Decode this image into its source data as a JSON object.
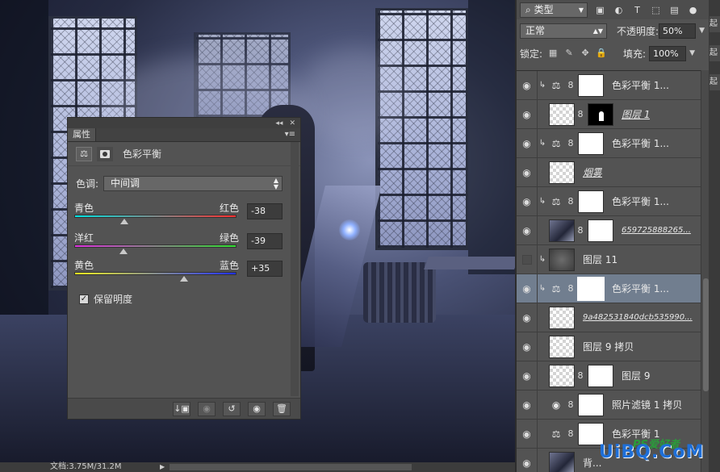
{
  "properties_panel": {
    "tab_label": "属性",
    "collapse_glyph": "◂◂",
    "close_glyph": "✕",
    "menu_glyph": "▾≡",
    "adjustment_name": "色彩平衡",
    "tone_label": "色调:",
    "tone_value": "中间调",
    "sliders": [
      {
        "left_label": "青色",
        "right_label": "红色",
        "value": "-38",
        "numeric": -38
      },
      {
        "left_label": "洋红",
        "right_label": "绿色",
        "value": "-39",
        "numeric": -39
      },
      {
        "left_label": "黄色",
        "right_label": "蓝色",
        "value": "+35",
        "numeric": 35
      }
    ],
    "preserve_luminosity_label": "保留明度",
    "preserve_luminosity_checked": true
  },
  "layers_panel": {
    "filter_label": "类型",
    "blend_mode": "正常",
    "opacity_label": "不透明度:",
    "opacity_value": "50%",
    "lock_label": "锁定:",
    "fill_label": "填充:",
    "fill_value": "100%",
    "layers": [
      {
        "name": "色彩平衡 1...",
        "visible": true,
        "clipped": true,
        "adjustment": true,
        "thumb": "white",
        "mask": true,
        "style": ""
      },
      {
        "name": "图层 1",
        "visible": true,
        "clipped": false,
        "adjustment": false,
        "thumb": "check",
        "mask_thumb": "black",
        "style": "u"
      },
      {
        "name": "色彩平衡 1...",
        "visible": true,
        "clipped": true,
        "adjustment": true,
        "thumb": "white",
        "mask": true,
        "style": ""
      },
      {
        "name": "烟雾",
        "visible": true,
        "clipped": false,
        "adjustment": false,
        "thumb": "check",
        "style": "u"
      },
      {
        "name": "色彩平衡 1...",
        "visible": true,
        "clipped": true,
        "adjustment": true,
        "thumb": "white",
        "mask": true,
        "style": ""
      },
      {
        "name": "659725888265...",
        "visible": true,
        "clipped": false,
        "adjustment": false,
        "thumb": "photo",
        "mask_thumb": "white",
        "style": "u small"
      },
      {
        "name": "图层 11",
        "visible": false,
        "clipped": true,
        "adjustment": false,
        "thumb": "gray",
        "style": ""
      },
      {
        "name": "色彩平衡 1...",
        "visible": true,
        "clipped": true,
        "adjustment": true,
        "thumb": "white",
        "mask": true,
        "style": "",
        "selected": true
      },
      {
        "name": "9a482531840dcb535990...",
        "visible": true,
        "clipped": false,
        "adjustment": false,
        "thumb": "check",
        "style": "u small"
      },
      {
        "name": "图层 9 拷贝",
        "visible": true,
        "clipped": false,
        "adjustment": false,
        "thumb": "check",
        "style": ""
      },
      {
        "name": "图层 9",
        "visible": true,
        "clipped": false,
        "adjustment": false,
        "thumb": "check",
        "mask_thumb": "white",
        "style": ""
      },
      {
        "name": "照片滤镜 1 拷贝",
        "visible": true,
        "clipped": false,
        "adjustment": true,
        "adj_icon": "◉",
        "thumb": "white",
        "mask": true,
        "style": ""
      },
      {
        "name": "色彩平衡 1",
        "visible": true,
        "clipped": false,
        "adjustment": true,
        "thumb": "white",
        "mask": true,
        "style": ""
      },
      {
        "name": "背...",
        "visible": true,
        "clipped": false,
        "adjustment": false,
        "thumb": "photo",
        "style": ""
      }
    ]
  },
  "status_bar": {
    "doc_info": "文档:3.75M/31.2M"
  },
  "edge_tabs": [
    "起浊",
    "起浊",
    "起浊"
  ],
  "watermark": {
    "text": "UiBQ.CoM",
    "sub": "PS爱好者"
  },
  "colors": {
    "panel_bg": "#535353",
    "selected_layer": "#717e8f",
    "cyan_red_track": [
      "#00e5e5",
      "#ff3030"
    ],
    "magenta_green_track": [
      "#e030e0",
      "#30e030"
    ],
    "yellow_blue_track": [
      "#f0f020",
      "#2030ff"
    ]
  }
}
